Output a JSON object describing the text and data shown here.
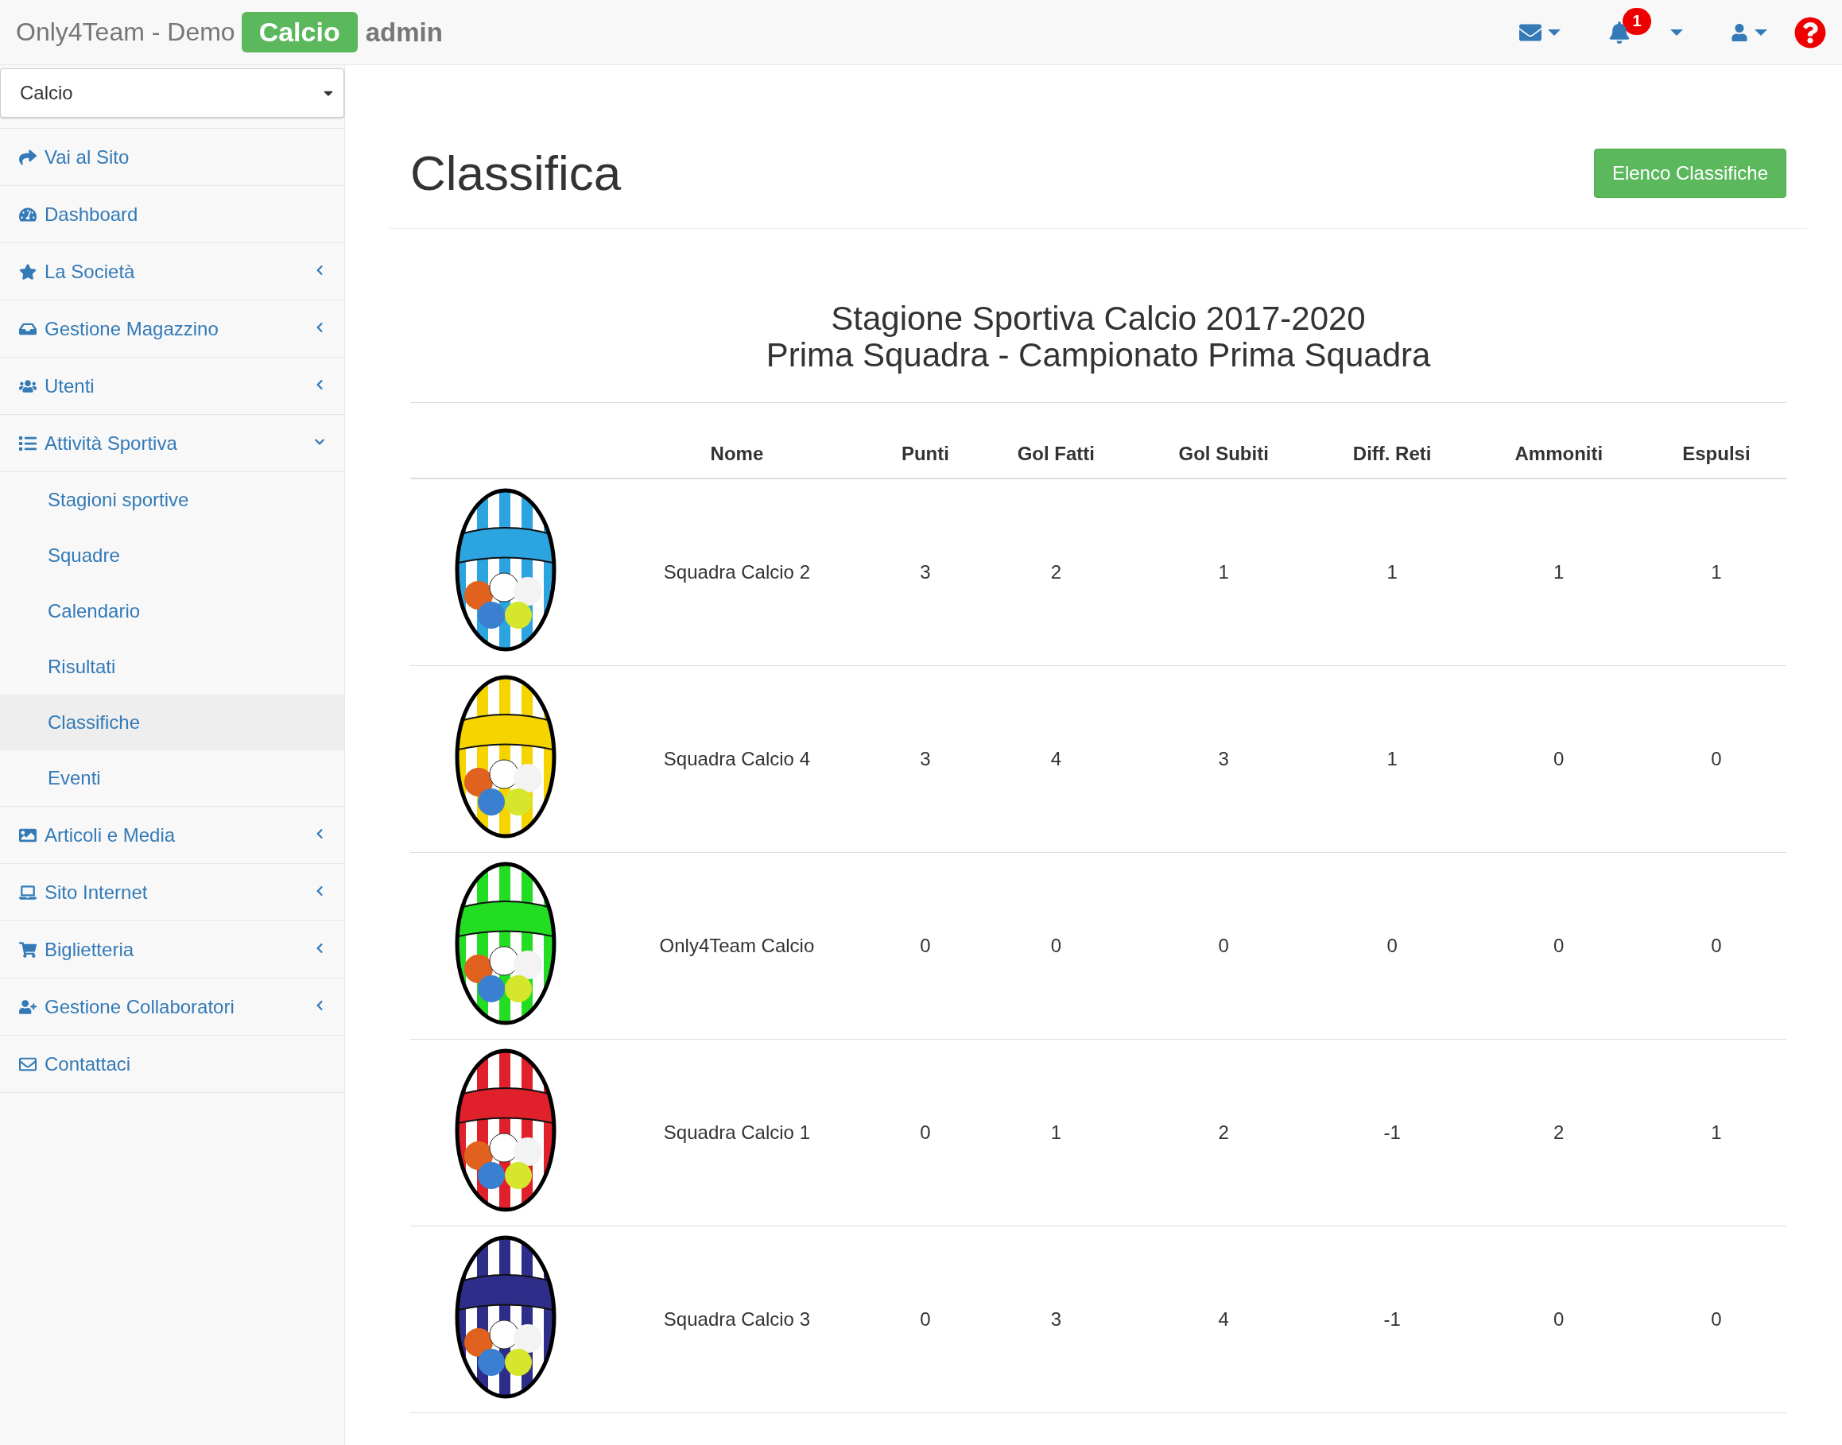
{
  "header": {
    "brand": "Only4Team - Demo",
    "section_badge": "Calcio",
    "user": "admin",
    "notifications_count": "1"
  },
  "sidebar": {
    "select": {
      "value": "Calcio"
    },
    "items": [
      {
        "label": "Vai al Sito"
      },
      {
        "label": "Dashboard"
      },
      {
        "label": "La Società",
        "expanded": false
      },
      {
        "label": "Gestione Magazzino",
        "expanded": false
      },
      {
        "label": "Utenti",
        "expanded": false
      },
      {
        "label": "Attività Sportiva",
        "expanded": true,
        "children": [
          {
            "label": "Stagioni sportive",
            "selected": false
          },
          {
            "label": "Squadre",
            "selected": false
          },
          {
            "label": "Calendario",
            "selected": false
          },
          {
            "label": "Risultati",
            "selected": false
          },
          {
            "label": "Classifiche",
            "selected": true
          },
          {
            "label": "Eventi",
            "selected": false
          }
        ]
      },
      {
        "label": "Articoli e Media",
        "expanded": false
      },
      {
        "label": "Sito Internet",
        "expanded": false
      },
      {
        "label": "Biglietteria",
        "expanded": false
      },
      {
        "label": "Gestione Collaboratori",
        "expanded": false
      },
      {
        "label": "Contattaci"
      }
    ]
  },
  "page": {
    "title": "Classifica",
    "action_button": "Elenco Classifiche",
    "heading_lines": [
      "Stagione Sportiva Calcio 2017-2020",
      "Prima Squadra - Campionato Prima Squadra"
    ],
    "table": {
      "columns": [
        "Nome",
        "Punti",
        "Gol Fatti",
        "Gol Subiti",
        "Diff. Reti",
        "Ammoniti",
        "Espulsi"
      ],
      "rows": [
        {
          "color": "#2ba4e0",
          "cells": [
            "Squadra Calcio 2",
            "3",
            "2",
            "1",
            "1",
            "1",
            "1"
          ]
        },
        {
          "color": "#f5d400",
          "cells": [
            "Squadra Calcio 4",
            "3",
            "4",
            "3",
            "1",
            "0",
            "0"
          ]
        },
        {
          "color": "#22dd22",
          "cells": [
            "Only4Team Calcio",
            "0",
            "0",
            "0",
            "0",
            "0",
            "0"
          ]
        },
        {
          "color": "#e0202a",
          "cells": [
            "Squadra Calcio 1",
            "0",
            "1",
            "2",
            "-1",
            "2",
            "1"
          ]
        },
        {
          "color": "#2e2e8a",
          "cells": [
            "Squadra Calcio 3",
            "0",
            "3",
            "4",
            "-1",
            "0",
            "0"
          ]
        }
      ]
    }
  }
}
